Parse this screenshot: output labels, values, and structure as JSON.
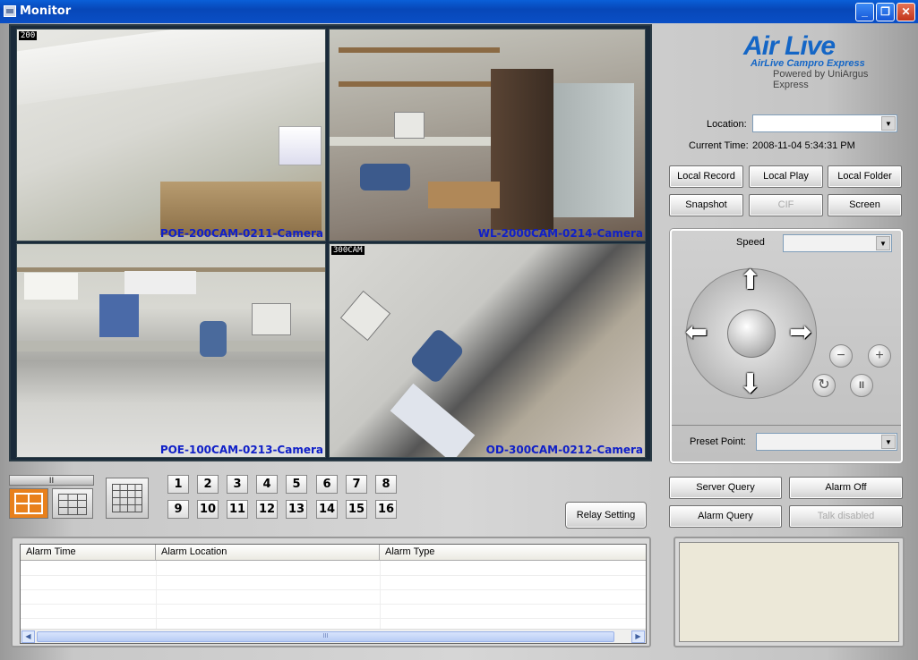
{
  "window": {
    "title": "Monitor",
    "minimize": "_",
    "maximize": "❐",
    "close": "✕"
  },
  "cameras": [
    {
      "tag": "200",
      "label": "POE-200CAM-0211-Camera"
    },
    {
      "tag": "",
      "label": "WL-2000CAM-0214-Camera"
    },
    {
      "tag": "",
      "label": "POE-100CAM-0213-Camera"
    },
    {
      "tag": "300CAM",
      "label": "OD-300CAM-0212-Camera"
    }
  ],
  "logo": {
    "brand": "Air Live",
    "sub": "AirLive Campro Express",
    "powered": "Powered by UniArgus Express"
  },
  "location": {
    "label": "Location:",
    "value": ""
  },
  "current_time": {
    "label": "Current Time:",
    "value": "2008-11-04 5:34:31 PM"
  },
  "buttons": {
    "local_record": "Local Record",
    "local_play": "Local Play",
    "local_folder": "Local Folder",
    "snapshot": "Snapshot",
    "cif": "CIF",
    "screen": "Screen",
    "server_query": "Server Query",
    "alarm_off": "Alarm Off",
    "alarm_query": "Alarm Query",
    "talk_disabled": "Talk disabled",
    "relay_setting": "Relay Setting"
  },
  "ptz": {
    "speed_label": "Speed",
    "speed_value": "",
    "preset_label": "Preset Point:",
    "preset_value": "",
    "zoom_out": "−",
    "zoom_in": "+",
    "pause": "II"
  },
  "channels": [
    "1",
    "2",
    "3",
    "4",
    "5",
    "6",
    "7",
    "8",
    "9",
    "10",
    "11",
    "12",
    "13",
    "14",
    "15",
    "16"
  ],
  "layout_pause": "II",
  "alarm_table": {
    "columns": [
      "Alarm Time",
      "Alarm Location",
      "Alarm Type"
    ],
    "rows": [],
    "scroll_grip": "III"
  },
  "colors": {
    "accent": "#1466c6",
    "camera_label": "#1020c8",
    "layout_active": "#e8801c"
  }
}
